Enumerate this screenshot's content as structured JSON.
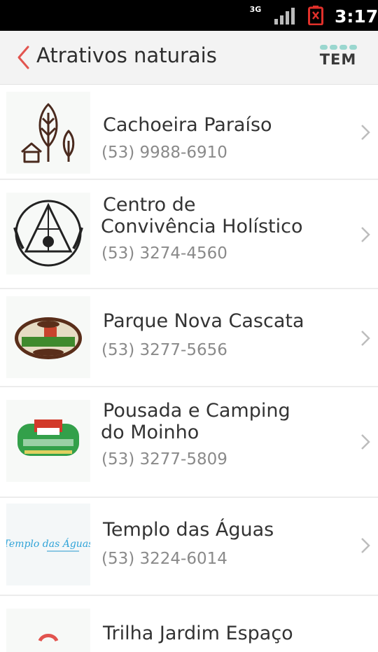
{
  "status_bar": {
    "network": "3G",
    "time": "3:17"
  },
  "app_bar": {
    "title": "Atrativos naturais",
    "logo_text": "TEM"
  },
  "items": [
    {
      "name_lines": [
        "Cachoeira Paraíso"
      ],
      "phone": "(53) 9988-6910",
      "icon": "nature-trees-house-icon"
    },
    {
      "name_lines": [
        "Centro de",
        "Convivência Holístico"
      ],
      "phone": "(53) 3274-4560",
      "icon": "holistic-center-logo"
    },
    {
      "name_lines": [
        "Parque Nova Cascata"
      ],
      "phone": "(53) 3277-5656",
      "icon": "parque-nova-cascata-logo"
    },
    {
      "name_lines": [
        "Pousada e Camping",
        "do Moinho"
      ],
      "phone": "(53) 3277-5809",
      "icon": "pousada-moinho-logo"
    },
    {
      "name_lines": [
        "Templo das Águas"
      ],
      "phone": "(53) 3224-6014",
      "icon": "templo-das-aguas-logo"
    },
    {
      "name_lines": [
        "Trilha Jardim Espaço"
      ],
      "phone": "",
      "icon": "trilha-jardim-logo"
    }
  ],
  "colors": {
    "accent": "#d9534f",
    "logo_dots": "#9ad7cf",
    "brown": "#5a2e1a"
  }
}
